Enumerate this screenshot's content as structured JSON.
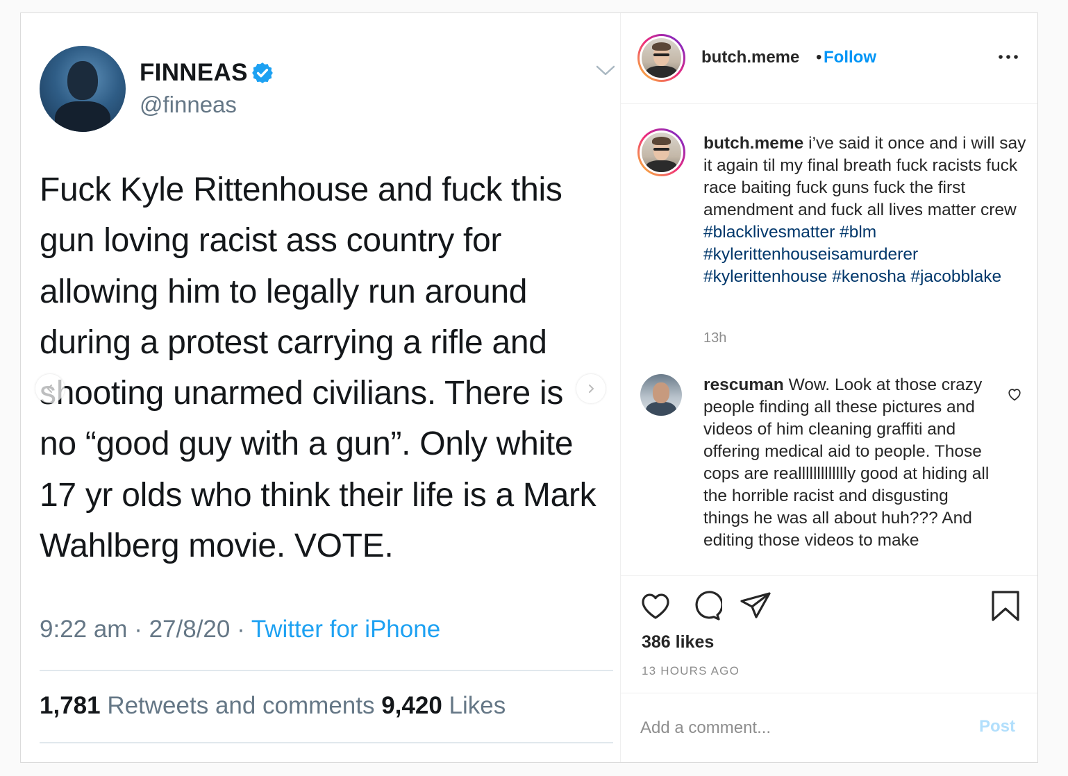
{
  "tweet": {
    "name": "FINNEAS",
    "handle": "@finneas",
    "text_lines": [
      "Fuck Kyle Rittenhouse and fuck this",
      "gun loving racist ass country for",
      "allowing him to legally run around",
      "during a protest carrying a rifle and",
      "shooting unarmed civilians. There is",
      "no “good guy with a gun”. Only white",
      "17 yr olds who think their life is a Mark",
      "Wahlberg movie. VOTE."
    ],
    "time": "9:22 am · 27/8/20 · ",
    "source": "Twitter for iPhone",
    "retweets_count": "1,781",
    "retweets_label": " Retweets and comments ",
    "likes_count": "9,420",
    "likes_label": " Likes",
    "icons": {
      "verified": "verified-badge-icon",
      "chevron": "chevron-down-icon"
    }
  },
  "post": {
    "username": "butch.meme",
    "dot": "•",
    "follow_label": "Follow",
    "caption_user": "butch.meme",
    "caption_text": " i’ve said it once and i will say it again til my final breath fuck racists fuck race baiting fuck guns fuck the first amendment and fuck all lives matter crew ",
    "hashtags": [
      "#blacklivesmatter",
      "#blm",
      "#kylerittenhouseisamurderer",
      "#kylerittenhouse",
      "#kenosha",
      "#jacobblake"
    ],
    "caption_age": "13h",
    "comment": {
      "user": "rescuman",
      "text": " Wow. Look at those crazy people finding all these pictures and videos of him cleaning graffiti and offering medical aid to people. Those cops are reallllllllllllly good at hiding all the horrible racist and disgusting things he was all about huh??? And editing those videos to make"
    },
    "likes": "386 likes",
    "time_ago": "13 HOURS AGO",
    "comment_placeholder": "Add a comment...",
    "post_label": "Post"
  },
  "colors": {
    "link_blue": "#0095f6",
    "hashtag": "#00376b",
    "twitter_blue": "#1da1f2",
    "post_disabled": "#b2dffc"
  }
}
